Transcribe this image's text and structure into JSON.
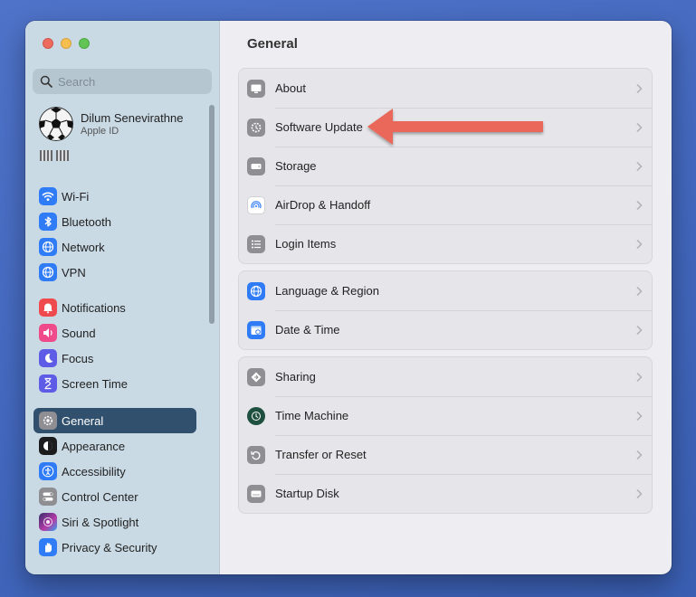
{
  "search": {
    "placeholder": "Search"
  },
  "account": {
    "name": "Dilum Senevirathne",
    "subtitle": "Apple ID"
  },
  "sidebar": {
    "groups": [
      {
        "items": [
          {
            "label": "Wi-Fi",
            "icon": "wifi-icon",
            "color": "#2f7cf6"
          },
          {
            "label": "Bluetooth",
            "icon": "bluetooth-icon",
            "color": "#2f7cf6"
          },
          {
            "label": "Network",
            "icon": "globe-icon",
            "color": "#2f7cf6"
          },
          {
            "label": "VPN",
            "icon": "globe-icon",
            "color": "#2f7cf6"
          }
        ]
      },
      {
        "items": [
          {
            "label": "Notifications",
            "icon": "bell-icon",
            "color": "#ef4b4f"
          },
          {
            "label": "Sound",
            "icon": "speaker-icon",
            "color": "#ef4b8a"
          },
          {
            "label": "Focus",
            "icon": "moon-icon",
            "color": "#5e5ce6"
          },
          {
            "label": "Screen Time",
            "icon": "hourglass-icon",
            "color": "#5e5ce6"
          }
        ]
      },
      {
        "items": [
          {
            "label": "General",
            "icon": "gear-icon",
            "color": "#8e8e93",
            "selected": true
          },
          {
            "label": "Appearance",
            "icon": "appearance-icon",
            "color": "#1c1c1e"
          },
          {
            "label": "Accessibility",
            "icon": "accessibility-icon",
            "color": "#2f7cf6"
          },
          {
            "label": "Control Center",
            "icon": "toggles-icon",
            "color": "#8e8e93"
          },
          {
            "label": "Siri & Spotlight",
            "icon": "siri-icon",
            "color": "#3a2b6e"
          },
          {
            "label": "Privacy & Security",
            "icon": "hand-icon",
            "color": "#2f7cf6"
          }
        ]
      }
    ]
  },
  "main": {
    "title": "General",
    "groups": [
      {
        "rows": [
          {
            "label": "About",
            "icon": "display-icon",
            "color": "#8e8e93"
          },
          {
            "label": "Software Update",
            "icon": "gear-update-icon",
            "color": "#8e8e93"
          },
          {
            "label": "Storage",
            "icon": "drive-icon",
            "color": "#8e8e93"
          },
          {
            "label": "AirDrop & Handoff",
            "icon": "airdrop-icon",
            "color": "#ffffff"
          },
          {
            "label": "Login Items",
            "icon": "list-icon",
            "color": "#8e8e93"
          }
        ]
      },
      {
        "rows": [
          {
            "label": "Language & Region",
            "icon": "globe-icon",
            "color": "#2f7cf6"
          },
          {
            "label": "Date & Time",
            "icon": "calendar-clock-icon",
            "color": "#2f7cf6"
          }
        ]
      },
      {
        "rows": [
          {
            "label": "Sharing",
            "icon": "sharing-icon",
            "color": "#8e8e93"
          },
          {
            "label": "Time Machine",
            "icon": "time-machine-icon",
            "color": "#1f4f3f"
          },
          {
            "label": "Transfer or Reset",
            "icon": "reset-icon",
            "color": "#8e8e93"
          },
          {
            "label": "Startup Disk",
            "icon": "disk-icon",
            "color": "#8e8e93"
          }
        ]
      }
    ]
  },
  "annotation_color": "#e9675a"
}
